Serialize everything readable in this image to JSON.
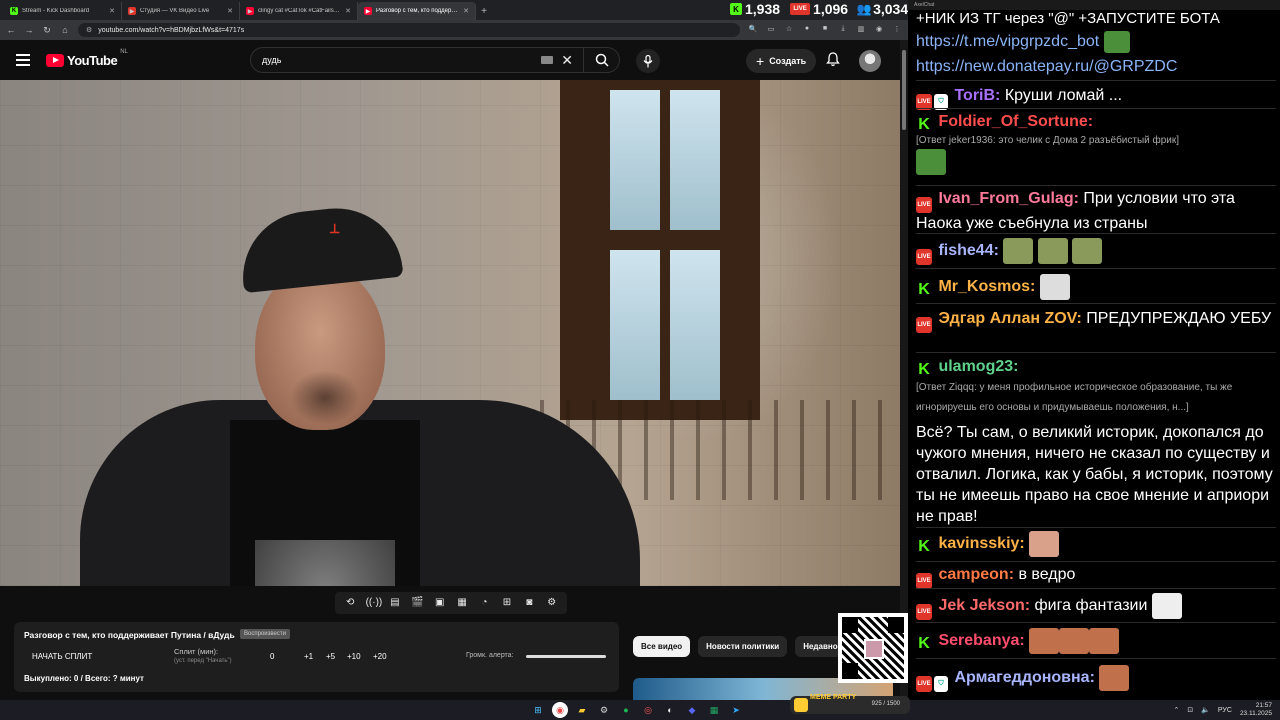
{
  "browser": {
    "tabs": [
      {
        "title": "Stream - Kick Dashboard",
        "favicon": "kick-icon",
        "color": "#53fc18",
        "active": false
      },
      {
        "title": "Студия — VK Видео Live",
        "favicon": "vk-icon",
        "color": "#e0352b",
        "active": false
      },
      {
        "title": "clingy cat #CatTok #CatFails202...",
        "favicon": "youtube-icon",
        "color": "#ff0033",
        "active": false
      },
      {
        "title": "Разговор с тем, кто поддерж...",
        "favicon": "youtube-icon",
        "color": "#ff0033",
        "active": true
      }
    ],
    "url": "youtube.com/watch?v=hBDMjbzLfWs&t=4717s"
  },
  "youtube": {
    "logo": "YouTube",
    "country": "NL",
    "search_value": "дудь",
    "create_label": "Создать"
  },
  "stats": {
    "kick_viewers": "1,938",
    "vk_viewers": "1,096",
    "total_viewers": "3,034"
  },
  "panel": {
    "title": "Разговор с тем, кто поддерживает Путина / вДудь",
    "badge": "Воспроизвести",
    "start_split": "НАЧАТЬ СПЛИТ",
    "split_label": "Сплит (мин):",
    "split_hint": "(уст. перед \"Начать\")",
    "split_value": "0",
    "split_buttons": [
      "+1",
      "+5",
      "+10",
      "+20"
    ],
    "volume_label": "Громк. алерта:",
    "volume_level": 1.0,
    "bought": "Выкуплено: 0 / Всего: ? минут"
  },
  "chips": [
    "Все видео",
    "Новости политики",
    "Недавно о"
  ],
  "chat": {
    "window_title": "AxelChat",
    "header_line": "+НИК ИЗ ТГ через \"@\" +ЗАПУСТИТЕ БОТА",
    "links": [
      "https://t.me/vipgrpzdc_bot",
      "https://new.donatepay.ru/@GRPZDC"
    ],
    "messages": [
      {
        "platform": "vk",
        "mod": true,
        "nick": "ToriB:",
        "color": "#a970ff",
        "text": "Круши ломай ..."
      },
      {
        "platform": "kick",
        "nick": "Foldier_Of_Sortune:",
        "color": "#ff4d4d",
        "reply": "[Ответ jeker1936: это челик с Дома 2 разъёбистый фрик]",
        "text": ""
      },
      {
        "platform": "vk",
        "nick": "Ivan_From_Gulag:",
        "color": "#ff7a9a",
        "text": "При условии что эта Наока уже съебнула из страны"
      },
      {
        "platform": "vk",
        "nick": "fishe44:",
        "color": "#a9b5ff",
        "text": ""
      },
      {
        "platform": "kick",
        "nick": "Mr_Kosmos:",
        "color": "#ffb347",
        "text": ""
      },
      {
        "platform": "vk",
        "nick": "Эдгар Аллан ZOV:",
        "color": "#ffb347",
        "text": "ПРЕДУПРЕЖДАЮ УЕБУ"
      },
      {
        "platform": "kick",
        "nick": "ulamog23:",
        "color": "#5fd18a",
        "reply": "[Ответ Ziqqq: у меня профильное историческое образование, ты же игнорируешь его основы и придумываешь положения, н...]",
        "text": "Всё? Ты сам, о великий историк, докопался до чужого мнения, ничего не сказал по существу и отвалил. Логика, как у бабы, я историк, поэтому ты не имеешь право на свое мнение и априори не прав!"
      },
      {
        "platform": "kick",
        "nick": "kavinsskiy:",
        "color": "#ffb347",
        "text": ""
      },
      {
        "platform": "vk",
        "nick": "campeon:",
        "color": "#ff7a45",
        "text": "в ведро"
      },
      {
        "platform": "vk",
        "nick": "Jek Jekson:",
        "color": "#ff6b6b",
        "text": "фига фантазии"
      },
      {
        "platform": "kick",
        "nick": "Serebanya:",
        "color": "#ff4d6d",
        "text": ""
      },
      {
        "platform": "vk",
        "mod": true,
        "nick": "Армагеддоновна:",
        "color": "#a9b5ff",
        "text": ""
      }
    ]
  },
  "taskbar": {
    "meme_label": "MEME PARTY",
    "meme_count": "925 / 1500",
    "lang": "РУС",
    "time": "21:57",
    "date": "23.11.2025"
  }
}
